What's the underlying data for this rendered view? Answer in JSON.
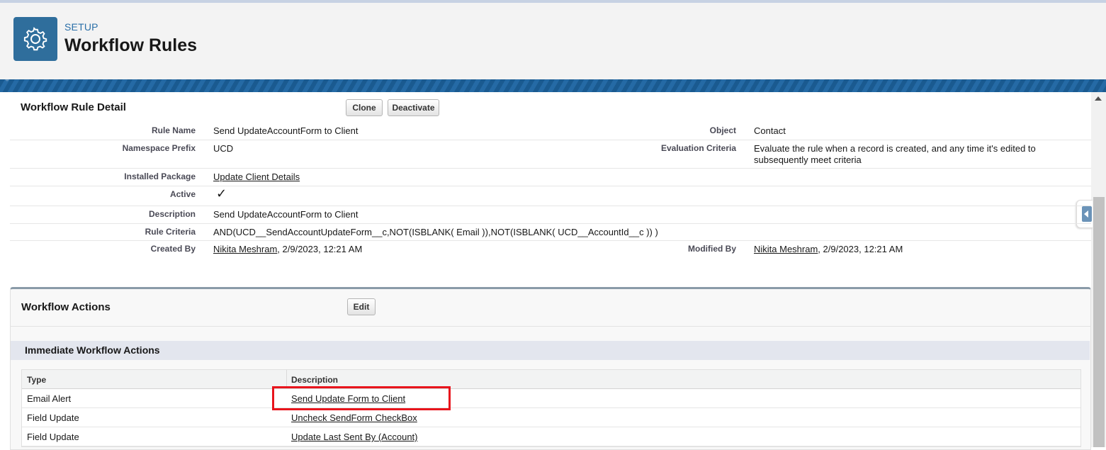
{
  "header": {
    "breadcrumb": "SETUP",
    "title": "Workflow Rules",
    "icon": "gear-icon"
  },
  "detail": {
    "section_title": "Workflow Rule Detail",
    "clone_label": "Clone",
    "deactivate_label": "Deactivate",
    "fields": {
      "rule_name_label": "Rule Name",
      "rule_name": "Send UpdateAccountForm to Client",
      "object_label": "Object",
      "object": "Contact",
      "namespace_label": "Namespace Prefix",
      "namespace": "UCD",
      "evaluation_label": "Evaluation Criteria",
      "evaluation": "Evaluate the rule when a record is created, and any time it's edited to subsequently meet criteria",
      "installed_package_label": "Installed Package",
      "installed_package": "Update Client Details",
      "active_label": "Active",
      "active": true,
      "description_label": "Description",
      "description": "Send UpdateAccountForm to Client",
      "rule_criteria_label": "Rule Criteria",
      "rule_criteria": "AND(UCD__SendAccountUpdateForm__c,NOT(ISBLANK( Email )),NOT(ISBLANK( UCD__AccountId__c )) )",
      "created_by_label": "Created By",
      "created_by_name": "Nikita Meshram",
      "created_by_date": ", 2/9/2023, 12:21 AM",
      "modified_by_label": "Modified By",
      "modified_by_name": "Nikita Meshram",
      "modified_by_date": ", 2/9/2023, 12:21 AM"
    }
  },
  "actions": {
    "section_title": "Workflow Actions",
    "edit_label": "Edit",
    "immediate_title": "Immediate Workflow Actions",
    "columns": [
      "Type",
      "Description"
    ],
    "rows": [
      {
        "type": "Email Alert",
        "description": "Send Update Form to Client"
      },
      {
        "type": "Field Update",
        "description": "Uncheck SendForm CheckBox"
      },
      {
        "type": "Field Update",
        "description": "Update Last Sent By (Account)"
      }
    ]
  },
  "colors": {
    "header_icon_bg": "#2f6e9c",
    "highlight_box": "#e8141c"
  }
}
